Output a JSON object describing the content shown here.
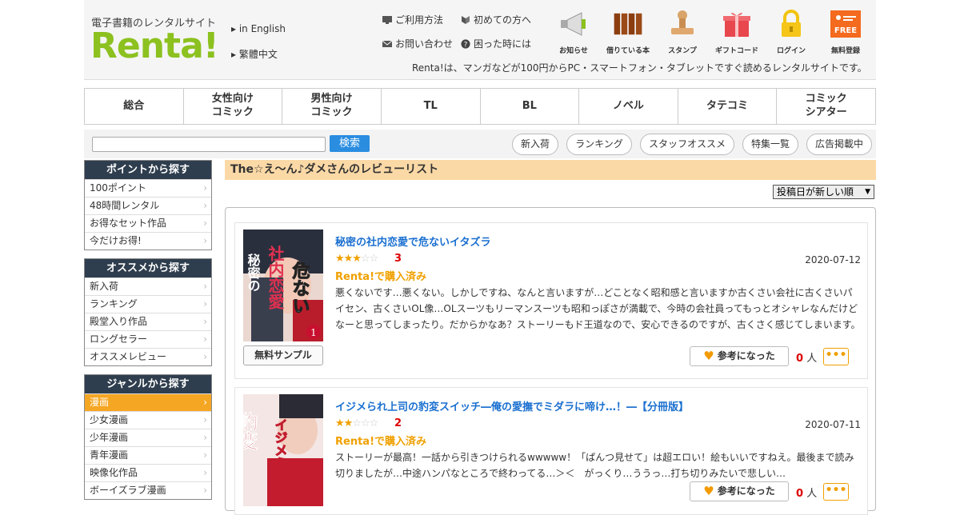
{
  "header": {
    "tagline": "電子書籍のレンタルサイト",
    "logo": "Renta!",
    "lang_en": "▸ in English",
    "lang_tw": "▸ 繁體中文",
    "links": [
      "ご利用方法",
      "初めての方へ",
      "お問い合わせ",
      "困った時には"
    ],
    "icons": [
      {
        "label": "お知らせ",
        "icon": "megaphone-icon"
      },
      {
        "label": "借りている本",
        "icon": "books-icon"
      },
      {
        "label": "スタンプ",
        "icon": "stamp-icon"
      },
      {
        "label": "ギフトコード",
        "icon": "gift-icon"
      },
      {
        "label": "ログイン",
        "icon": "lock-icon"
      },
      {
        "label": "無料登録",
        "icon": "free-registration-icon"
      }
    ],
    "description": "Renta!は、マンガなどが100円からPC・スマートフォン・タブレットですぐ読めるレンタルサイトです。"
  },
  "nav": [
    "総合",
    "女性向け\nコミック",
    "男性向け\nコミック",
    "TL",
    "BL",
    "ノベル",
    "タテコミ",
    "コミック\nシアター"
  ],
  "search": {
    "placeholder": "",
    "button": "検索"
  },
  "pills": [
    "新入荷",
    "ランキング",
    "スタッフオススメ",
    "特集一覧",
    "広告掲載中"
  ],
  "sidebar": {
    "points": {
      "title": "ポイントから探す",
      "items": [
        "100ポイント",
        "48時間レンタル",
        "お得なセット作品",
        "今だけお得!"
      ]
    },
    "recommend": {
      "title": "オススメから探す",
      "items": [
        "新入荷",
        "ランキング",
        "殿堂入り作品",
        "ロングセラー",
        "オススメレビュー"
      ]
    },
    "genre": {
      "title": "ジャンルから探す",
      "items": [
        "漫画",
        "少女漫画",
        "少年漫画",
        "青年漫画",
        "映像化作品",
        "ボーイズラブ漫画"
      ]
    }
  },
  "main": {
    "title": "The☆え～ん♪ダメさんのレビューリスト",
    "sort": "投稿日が新しい順"
  },
  "reviews": [
    {
      "title": "秘密の社内恋愛で危ないイタズラ",
      "rating": 3,
      "score": "3",
      "date": "2020-07-12",
      "bought": "Renta!で購入済み",
      "text": "悪くないです…悪くない。しかしですね、なんと言いますが…どことなく昭和感と言いますか古くさい会社に古くさいパイセン、古くさいOL像…OLスーツもリーマンスーツも昭和っぽさが満載で、今時の会社員ってもっとオシャレなんだけどなーと思ってしまったり。だからかなあ？ストーリーもド王道なので、安心できるのですが、古くさく感じてしまいます。",
      "sample": "無料サンプル",
      "helpful": "参考になった",
      "count": "0",
      "unit": "人",
      "more": "•••",
      "cover_text": "秘密の社内恋愛で危ないイタズラ",
      "cover_author": "小路たや",
      "cover_vol": "1"
    },
    {
      "title": "イジメられ上司の豹変スイッチ―俺の愛撫でミダラに啼け…！―【分冊版】",
      "rating": 2,
      "score": "2",
      "date": "2020-07-11",
      "bought": "Renta!で購入済み",
      "text": "ストーリーが最高！一話から引きつけられるwwwww！「ぱんつ見せて」は超エロい！絵もいいですねえ。最後まで読み切りましたが…中途ハンパなところで終わってる…＞＜　がっくり…ううっ…打ち切りみたいで悲しい…",
      "helpful": "参考になった",
      "count": "0",
      "unit": "人",
      "more": "•••",
      "cover_text": "イジメられ上司の豹変スイッチ"
    }
  ],
  "colors": {
    "accent": "#f5a623",
    "brand": "#8cc11f",
    "link": "#1a6fd0",
    "sidebar_header": "#2f3e4e"
  }
}
